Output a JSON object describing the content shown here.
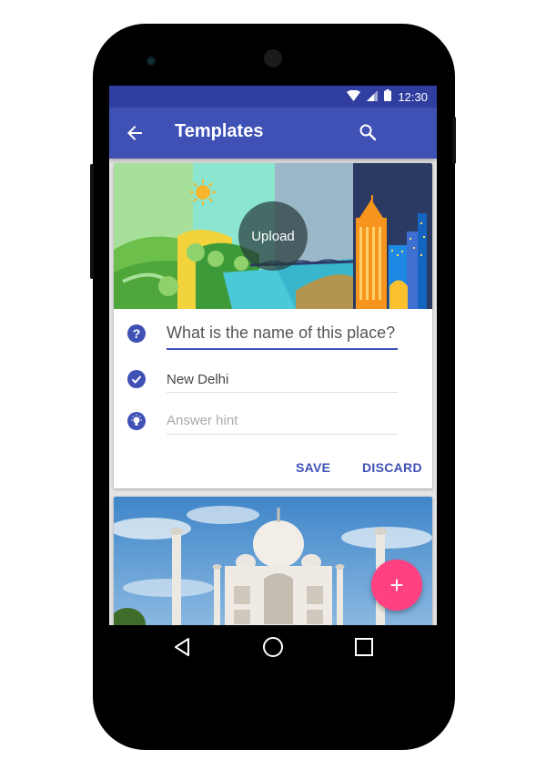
{
  "statusbar": {
    "time": "12:30"
  },
  "appbar": {
    "title": "Templates"
  },
  "card": {
    "upload_label": "Upload",
    "question_value": "What is the name of this place?",
    "answer_value": "New Delhi",
    "hint_placeholder": "Answer hint",
    "save_label": "SAVE",
    "discard_label": "DISCARD"
  },
  "fab": {
    "label": "+"
  },
  "colors": {
    "primary": "#3f51b5",
    "primary_dark": "#303f9f",
    "accent": "#ff4081"
  }
}
